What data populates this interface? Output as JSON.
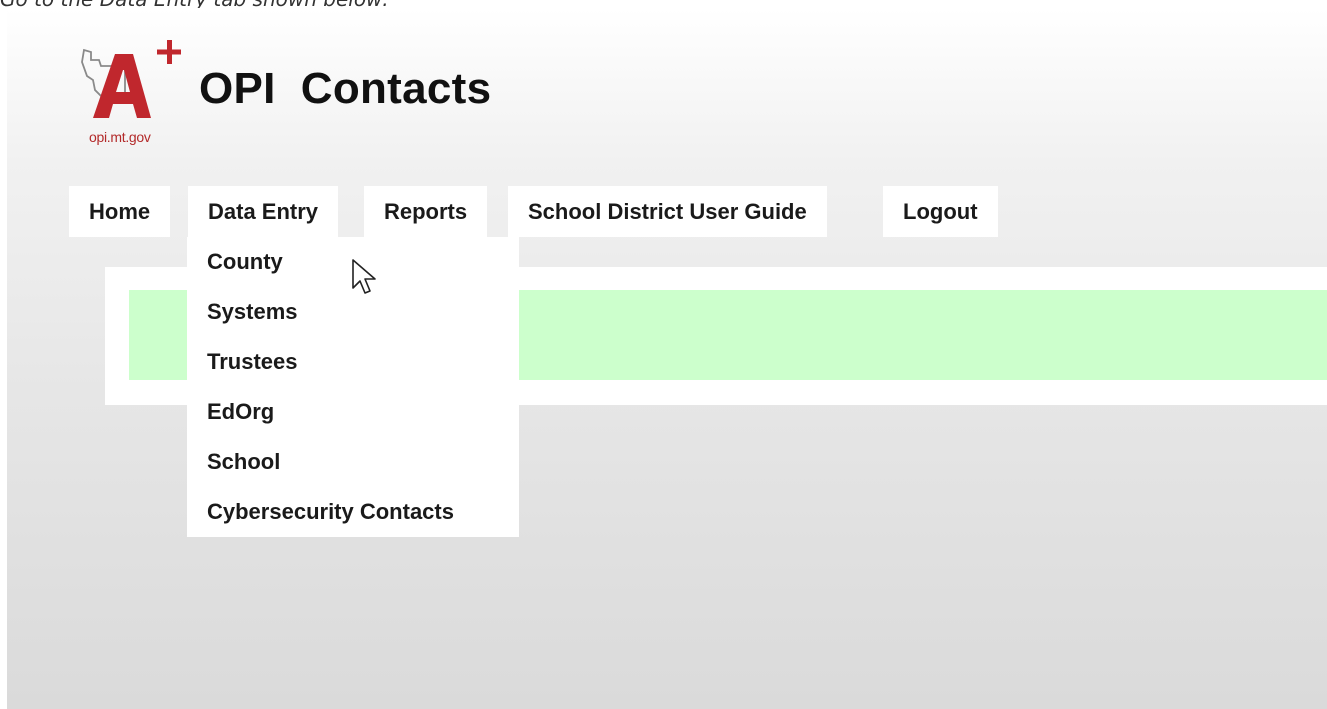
{
  "caption": "Go to the Data Entry tab shown below:",
  "header": {
    "logo_text": "opi.mt.gov",
    "title": "OPI  Contacts"
  },
  "nav": {
    "items": [
      {
        "label": "Home"
      },
      {
        "label": "Data Entry"
      },
      {
        "label": "Reports"
      },
      {
        "label": "School District User Guide"
      },
      {
        "label": "Logout"
      }
    ]
  },
  "dropdown": {
    "parent": "Data Entry",
    "items": [
      {
        "label": "County"
      },
      {
        "label": "Systems"
      },
      {
        "label": "Trustees"
      },
      {
        "label": "EdOrg"
      },
      {
        "label": "School"
      },
      {
        "label": "Cybersecurity Contacts"
      }
    ]
  },
  "colors": {
    "logo_red": "#b32a2a",
    "alert_green": "#ccffcc",
    "nav_background": "#ffffff"
  },
  "icons": {
    "logo": "montana-a-plus-logo",
    "cursor": "mouse-pointer-icon"
  }
}
